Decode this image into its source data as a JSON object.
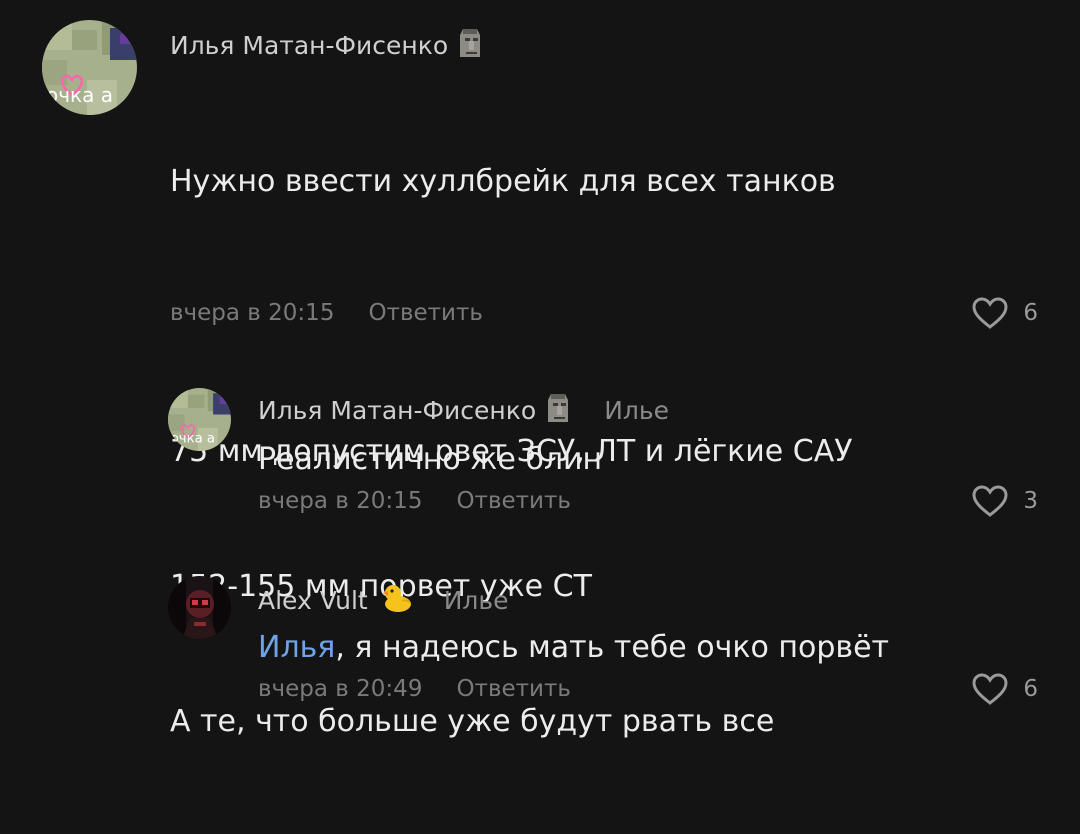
{
  "colors": {
    "background": "#141414",
    "mention": "#6fa3e6",
    "meta": "#7a7a7a"
  },
  "comments": [
    {
      "author": "Илья Матан-Фисенко",
      "author_emoji": "moai-icon",
      "avatar_text": "очка а",
      "text_lines": [
        "Нужно ввести хуллбрейк для всех танков",
        "",
        "75 мм допустим рвет ЗСУ, ЛТ и лёгкие САУ",
        "152-155 мм порвет уже СТ",
        "А те, что больше уже будут рвать все"
      ],
      "time": "вчера в 20:15",
      "reply_label": "Ответить",
      "likes": "6"
    },
    {
      "author": "Илья Матан-Фисенко",
      "author_emoji": "moai-icon",
      "avatar_text": "очка а",
      "reply_to": "Илье",
      "text": "Реалистично же блин",
      "time": "вчера в 20:15",
      "reply_label": "Ответить",
      "likes": "3"
    },
    {
      "author": "Alex Vult",
      "author_emoji": "duck-icon",
      "reply_to": "Илье",
      "mention": "Илья",
      "text": ", я надеюсь мать тебе очко порвёт",
      "time": "вчера в 20:49",
      "reply_label": "Ответить",
      "likes": "6"
    }
  ]
}
